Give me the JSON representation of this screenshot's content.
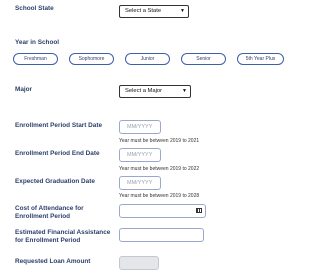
{
  "school_state": {
    "label": "School State",
    "value": "Select a State"
  },
  "year_in_school": {
    "label": "Year in School",
    "options": [
      "Freshman",
      "Sophomore",
      "Junior",
      "Senior",
      "5th Year Plus"
    ]
  },
  "major": {
    "label": "Major",
    "value": "Select a Major"
  },
  "enrollment_start": {
    "label": "Enrollment Period Start Date",
    "placeholder": "MM/YYYY",
    "hint": "Year must be between 2019 to 2021"
  },
  "enrollment_end": {
    "label": "Enrollment Period End Date",
    "placeholder": "MM/YYYY",
    "hint": "Year must be between 2019 to 2022"
  },
  "graduation": {
    "label": "Expected Graduation Date",
    "placeholder": "MM/YYYY",
    "hint": "Year must be between 2019 to 2028"
  },
  "cost_attendance": {
    "label": "Cost of Attendance for Enrollment Period"
  },
  "financial_assistance": {
    "label": "Estimated Financial Assistance for Enrollment Period"
  },
  "requested_loan": {
    "label": "Requested Loan Amount"
  },
  "icons": {
    "dropdown": "chevron-down-icon",
    "calculator": "calculator-icon"
  }
}
